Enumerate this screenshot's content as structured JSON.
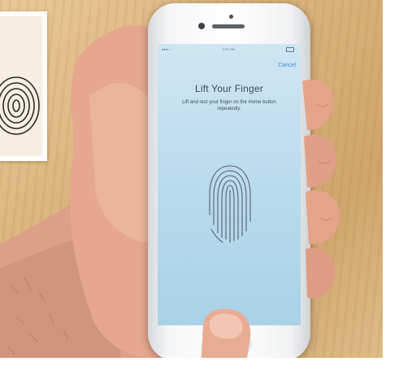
{
  "screen": {
    "status": {
      "carrier": "●●●○○ ",
      "time": "2:51 PM"
    },
    "cancel_label": "Cancel",
    "title": "Lift Your Finger",
    "instructions": "Lift and rest your finger on the Home button repeatedly."
  },
  "colors": {
    "table_wood": "#d9b27b",
    "phone_body": "#f5f6f7",
    "screen_blue": "#bcdcee",
    "fingerprint": "#56606a",
    "skin": "#e7ac92"
  }
}
